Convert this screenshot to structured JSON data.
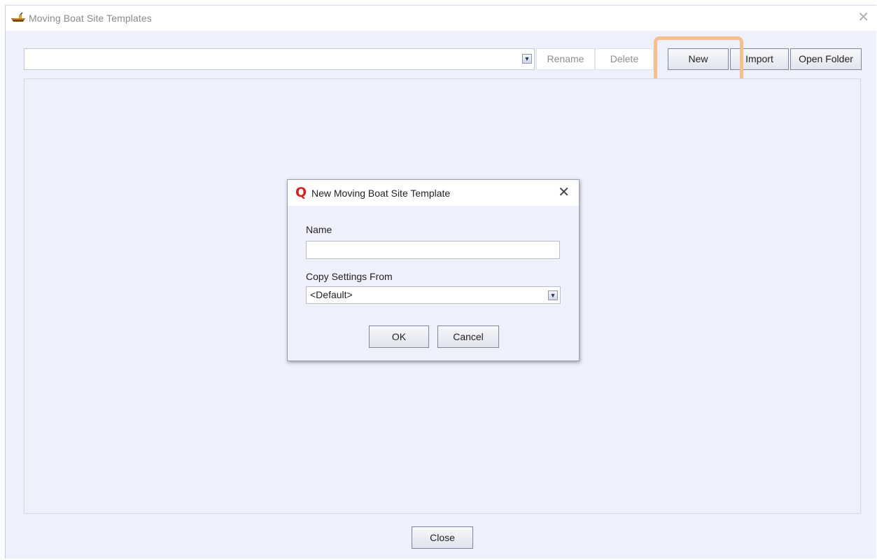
{
  "window": {
    "title": "Moving Boat Site Templates"
  },
  "toolbar": {
    "template_value": "",
    "rename_label": "Rename",
    "delete_label": "Delete",
    "new_label": "New",
    "import_label": "Import",
    "open_folder_label": "Open Folder"
  },
  "footer": {
    "close_label": "Close"
  },
  "dialog": {
    "title": "New Moving Boat Site Template",
    "name_label": "Name",
    "name_value": "",
    "copy_label": "Copy Settings From",
    "copy_value": "<Default>",
    "ok_label": "OK",
    "cancel_label": "Cancel"
  },
  "icons": {
    "app": "boat-icon",
    "dialog": "q-logo-icon",
    "close": "close-icon",
    "dropdown": "chevron-down-icon"
  },
  "colors": {
    "highlight": "#f6c08e",
    "window_bg": "#eef1fc",
    "logo_red": "#d32222"
  }
}
